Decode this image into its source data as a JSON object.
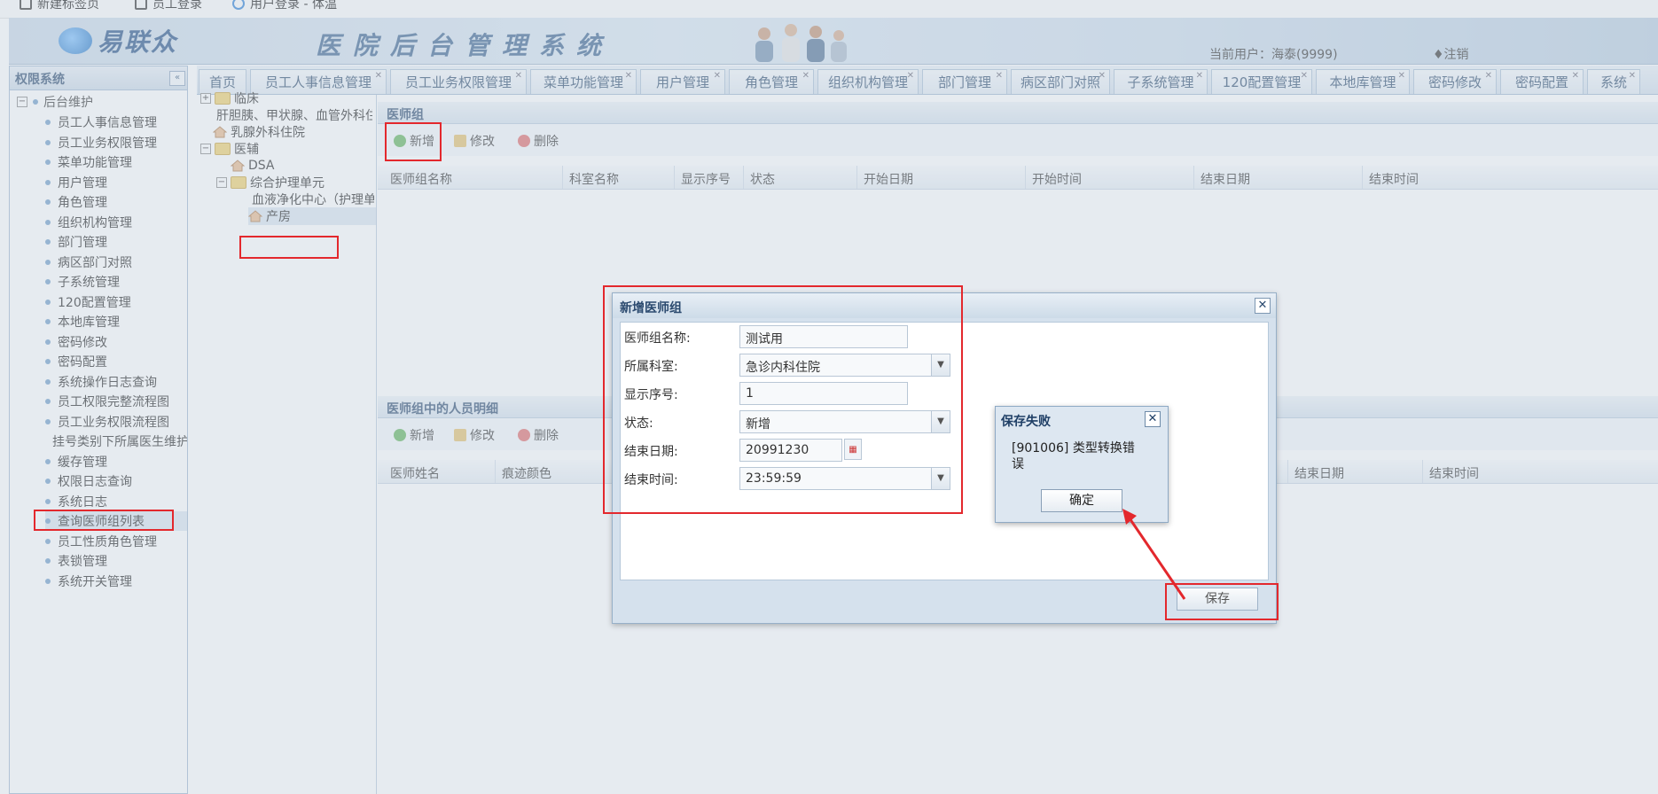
{
  "bookmarks": [
    {
      "label": "新建标签页",
      "icon": "new-tab-icon"
    },
    {
      "label": "员工登录",
      "icon": "page-icon"
    },
    {
      "label": "用户登录 - 体温",
      "icon": "globe-icon"
    }
  ],
  "header": {
    "logo_text": "易联众",
    "system_title": "医院后台管理系统",
    "current_user": "当前用户：海泰(9999)",
    "logout": "♦注销"
  },
  "sidebar": {
    "title": "权限系统",
    "collapse_icon": "«",
    "root": "后台维护",
    "items": [
      "员工人事信息管理",
      "员工业务权限管理",
      "菜单功能管理",
      "用户管理",
      "角色管理",
      "组织机构管理",
      "部门管理",
      "病区部门对照",
      "子系统管理",
      "120配置管理",
      "本地库管理",
      "密码修改",
      "密码配置",
      "系统操作日志查询",
      "员工权限完整流程图",
      "员工业务权限流程图",
      "挂号类别下所属医生维护",
      "缓存管理",
      "权限日志查询",
      "系统日志",
      "查询医师组列表",
      "员工性质角色管理",
      "表锁管理",
      "系统开关管理"
    ],
    "active_index": 20
  },
  "tabs": [
    "首页",
    "员工人事信息管理",
    "员工业务权限管理",
    "菜单功能管理",
    "用户管理",
    "角色管理",
    "组织机构管理",
    "部门管理",
    "病区部门对照",
    "子系统管理",
    "120配置管理",
    "本地库管理",
    "密码修改",
    "密码配置",
    "系统"
  ],
  "dept_tree": {
    "n0": "临床",
    "n1": "肝胆胰、甲状腺、血管外科住院",
    "n2": "乳腺外科住院",
    "n3": "医辅",
    "n4": "DSA",
    "n5": "综合护理单元",
    "n6": "血液净化中心（护理单元）",
    "n7": "产房"
  },
  "doctor_group": {
    "title": "医师组",
    "toolbar": {
      "add": "新增",
      "edit": "修改",
      "delete": "删除"
    },
    "columns": [
      "医师组名称",
      "科室名称",
      "显示序号",
      "状态",
      "开始日期",
      "开始时间",
      "结束日期",
      "结束时间"
    ]
  },
  "member_panel": {
    "title": "医师组中的人员明细",
    "toolbar": {
      "add": "新增",
      "edit": "修改",
      "delete": "删除"
    },
    "columns": [
      "医师姓名",
      "痕迹颜色",
      "结束日期",
      "结束时间"
    ]
  },
  "dialog": {
    "title": "新增医师组",
    "close": "✕",
    "fields": {
      "name_label": "医师组名称:",
      "name_value": "测试用",
      "dept_label": "所属科室:",
      "dept_value": "急诊内科住院",
      "order_label": "显示序号:",
      "order_value": "1",
      "status_label": "状态:",
      "status_value": "新增",
      "end_date_label": "结束日期:",
      "end_date_value": "20991230",
      "end_time_label": "结束时间:",
      "end_time_value": "23:59:59"
    },
    "save_label": "保存"
  },
  "error_popup": {
    "title": "保存失败",
    "close": "✕",
    "message": "[901006] 类型转换错误",
    "ok_label": "确定"
  },
  "colors": {
    "annotation": "#e3282d",
    "accent": "#2b4a6f"
  }
}
